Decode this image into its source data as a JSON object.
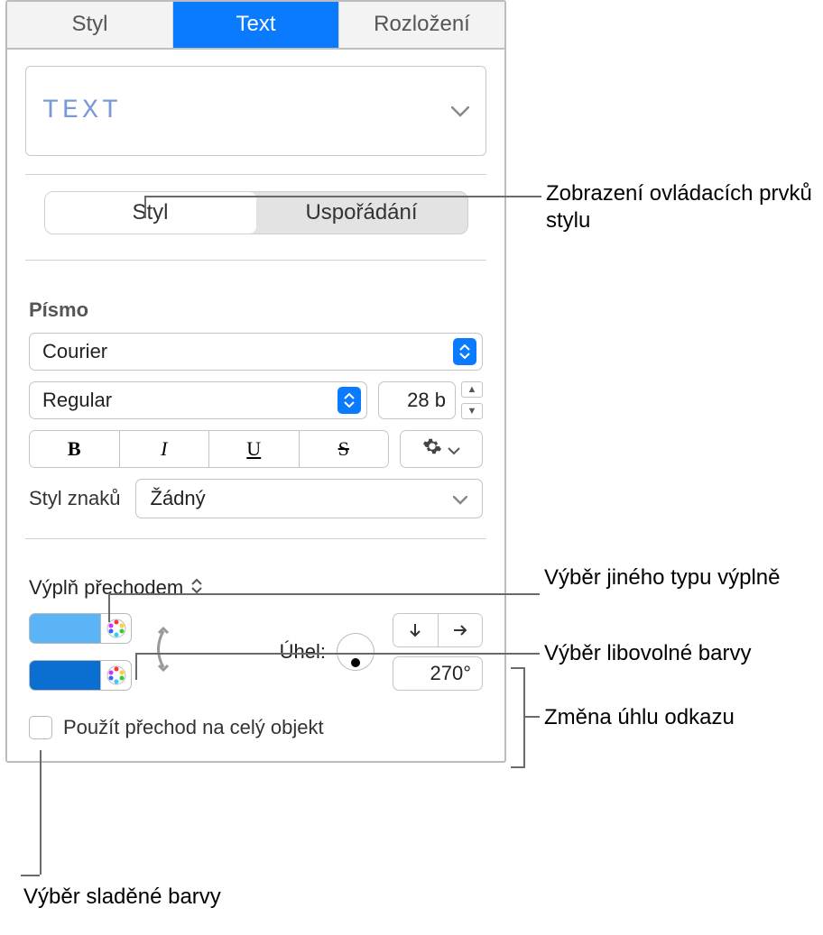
{
  "topbar": {
    "style": "Styl",
    "text": "Text",
    "layout": "Rozložení"
  },
  "paraStyle": {
    "label": "TEXT"
  },
  "segment": {
    "style": "Styl",
    "arrange": "Uspořádání"
  },
  "font": {
    "section": "Písmo",
    "family": "Courier",
    "weight": "Regular",
    "size": "28 b",
    "b": "B",
    "i": "I",
    "u": "U",
    "s": "S",
    "charLabel": "Styl znaků",
    "charValue": "Žádný"
  },
  "fill": {
    "type": "Výplň přechodem",
    "angleLabel": "Úhel:",
    "angleValue": "270°",
    "applyWhole": "Použít přechod na celý objekt"
  },
  "callouts": {
    "styleControls": "Zobrazení ovládacích prvků stylu",
    "fillType": "Výběr jiného typu výplně",
    "anyColor": "Výběr libovolné barvy",
    "angleChange": "Změna úhlu odkazu",
    "matchedColor": "Výběr sladěné barvy"
  }
}
